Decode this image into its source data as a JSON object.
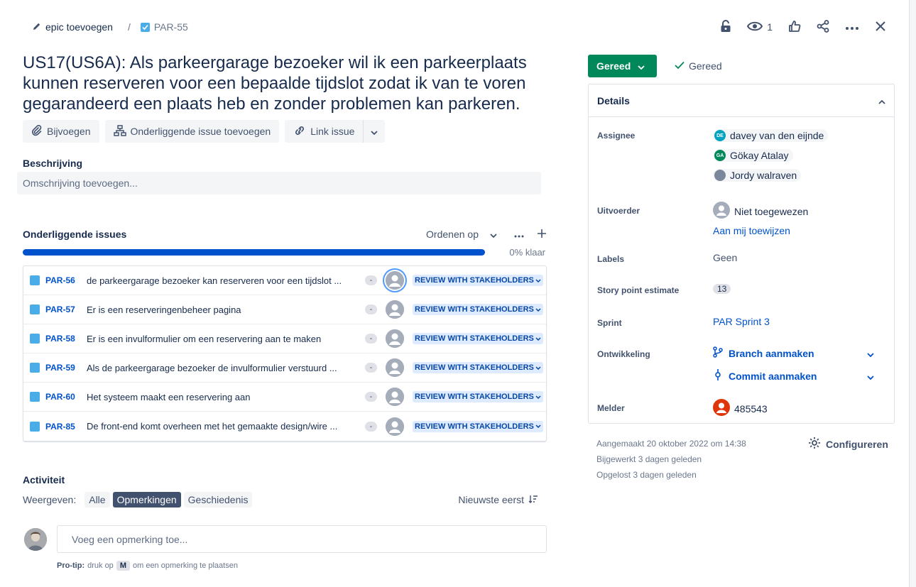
{
  "breadcrumb": {
    "epic_label": "epic toevoegen",
    "separator": "/",
    "issue_key": "PAR-55"
  },
  "top_actions": {
    "watch_count": "1"
  },
  "issue": {
    "title": "US17(US6A): Als parkeergarage bezoeker wil ik een parkeerplaats kunnen reserveren voor een bepaalde tijdslot zodat ik van te voren gegarandeerd een plaats heb en zonder problemen kan parkeren."
  },
  "actions": {
    "attach": "Bijvoegen",
    "add_child": "Onderliggende issue toevoegen",
    "link_issue": "Link issue"
  },
  "description": {
    "label": "Beschrijving",
    "placeholder": "Omschrijving toevoegen..."
  },
  "child_issues": {
    "label": "Onderliggende issues",
    "sort_label": "Ordenen op",
    "progress_text": "0% klaar",
    "progress_done_fraction": 0.0,
    "items": [
      {
        "key": "PAR-56",
        "summary": "de parkeergarage bezoeker kan reserveren voor een tijdslot ...",
        "priority": "-",
        "status": "REVIEW WITH STAKEHOLDERS"
      },
      {
        "key": "PAR-57",
        "summary": "Er is een reserveringenbeheer pagina",
        "priority": "-",
        "status": "REVIEW WITH STAKEHOLDERS"
      },
      {
        "key": "PAR-58",
        "summary": "Er is een invulformulier om een reservering aan te maken",
        "priority": "-",
        "status": "REVIEW WITH STAKEHOLDERS"
      },
      {
        "key": "PAR-59",
        "summary": "Als de parkeergarage bezoeker de invulformulier verstuurd ...",
        "priority": "-",
        "status": "REVIEW WITH STAKEHOLDERS"
      },
      {
        "key": "PAR-60",
        "summary": "Het systeem maakt een reservering aan",
        "priority": "-",
        "status": "REVIEW WITH STAKEHOLDERS"
      },
      {
        "key": "PAR-85",
        "summary": "De front-end komt overheen met het gemaakte design/wire ...",
        "priority": "-",
        "status": "REVIEW WITH STAKEHOLDERS"
      }
    ]
  },
  "activity": {
    "label": "Activiteit",
    "show_label": "Weergeven:",
    "filters": [
      "Alle",
      "Opmerkingen",
      "Geschiedenis"
    ],
    "active_filter": "Opmerkingen",
    "sort": "Nieuwste eerst",
    "comment_placeholder": "Voeg een opmerking toe...",
    "protip_label": "Pro-tip:",
    "protip_before": "druk op",
    "protip_key": "M",
    "protip_after": "om een opmerking te plaatsen"
  },
  "status": {
    "button_label": "Gereed",
    "resolution": "Gereed"
  },
  "details": {
    "header": "Details",
    "assignee_label": "Assignee",
    "assignees": [
      {
        "name": "davey van den eijnde",
        "initials": "DE",
        "color": "#00a3bf"
      },
      {
        "name": "Gökay Atalay",
        "initials": "GA",
        "color": "#00875a"
      },
      {
        "name": "Jordy walraven",
        "initials": "",
        "color": "#7a869a"
      }
    ],
    "executor_label": "Uitvoerder",
    "executor_value": "Niet toegewezen",
    "assign_to_me": "Aan mij toewijzen",
    "labels_label": "Labels",
    "labels_value": "Geen",
    "story_points_label": "Story point estimate",
    "story_points_value": "13",
    "sprint_label": "Sprint",
    "sprint_value": "PAR Sprint 3",
    "development_label": "Ontwikkeling",
    "create_branch": "Branch aanmaken",
    "create_commit": "Commit aanmaken",
    "reporter_label": "Melder",
    "reporter_value": "485543"
  },
  "meta": {
    "created": "Aangemaakt 20 oktober 2022 om 14:38",
    "updated": "Bijgewerkt 3 dagen geleden",
    "resolved": "Opgelost 3 dagen geleden",
    "configure": "Configureren"
  },
  "colors": {
    "primary": "#0052cc",
    "success": "#00875a",
    "status_bg": "#deebff",
    "status_text": "#0747a6",
    "story": "#4bade8",
    "reporter": "#de350b"
  }
}
